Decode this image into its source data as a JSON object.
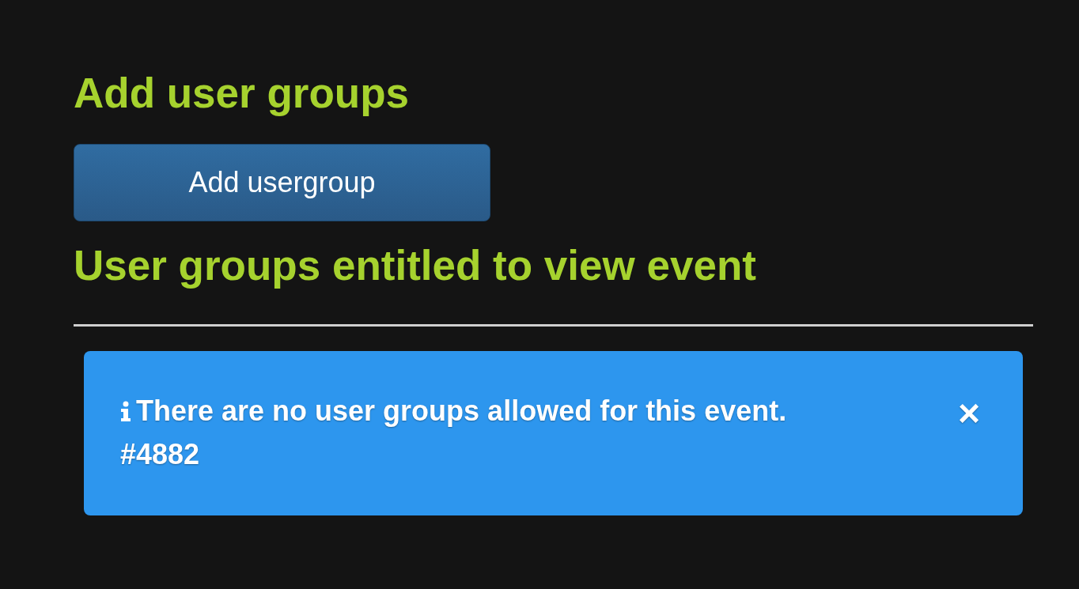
{
  "sections": [
    {
      "heading": "Add user groups"
    },
    {
      "heading": "User groups entitled to view event"
    }
  ],
  "add_button": {
    "label": "Add usergroup"
  },
  "alert": {
    "kind": "info",
    "message": "There are no user groups allowed for this event.",
    "reference": "#4882",
    "close": "×"
  }
}
